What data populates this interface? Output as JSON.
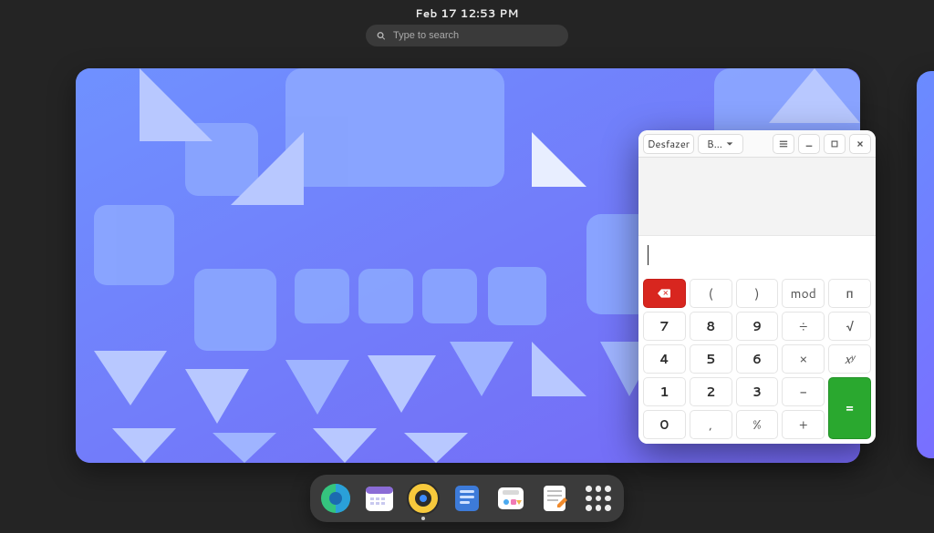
{
  "topbar": {
    "datetime": "Feb 17  12:53 PM"
  },
  "search": {
    "placeholder": "Type to search"
  },
  "calculator": {
    "undo_label": "Desfazer",
    "mode_label": "B…",
    "input_value": "",
    "keys": {
      "clear": "⌫",
      "lparen": "(",
      "rparen": ")",
      "mod": "mod",
      "pi": "π",
      "k7": "7",
      "k8": "8",
      "k9": "9",
      "div": "÷",
      "sqrt": "√",
      "k4": "4",
      "k5": "5",
      "k6": "6",
      "mul": "×",
      "pow": "xʸ",
      "k1": "1",
      "k2": "2",
      "k3": "3",
      "sub": "−",
      "equals": "=",
      "k0": "0",
      "dot": ",",
      "pct": "%",
      "add": "+"
    }
  },
  "dash": {
    "apps": [
      "Web",
      "Calendar",
      "Rhythmbox",
      "Files",
      "Software",
      "Text Editor"
    ]
  }
}
